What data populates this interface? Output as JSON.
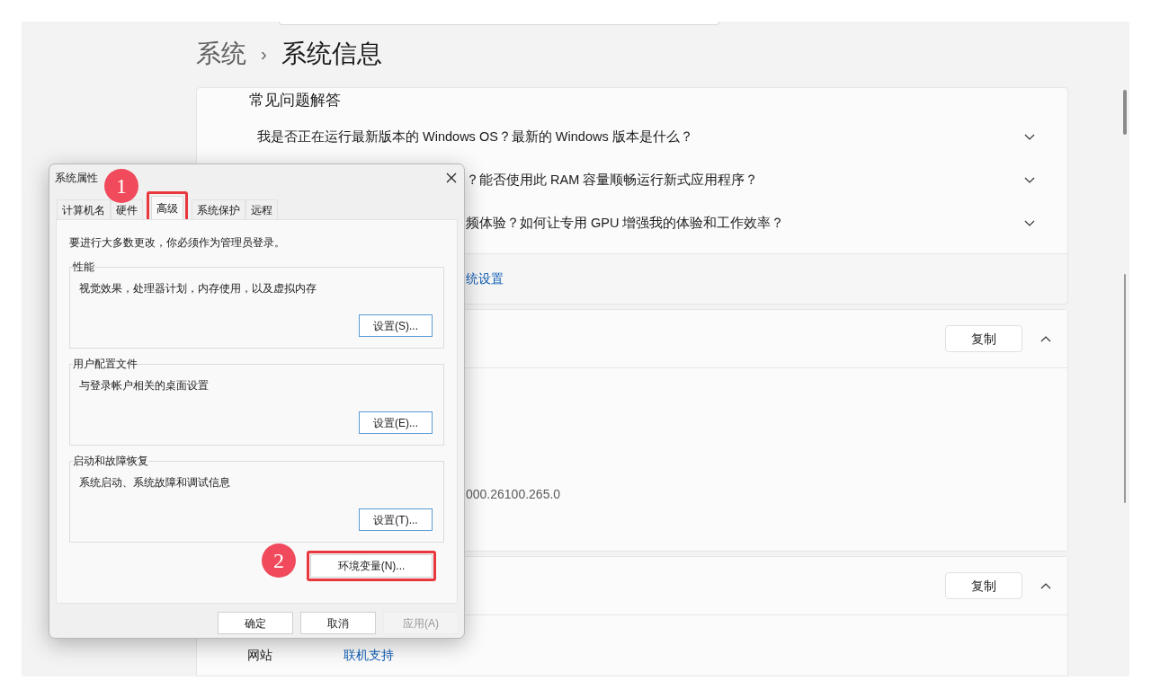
{
  "breadcrumb": {
    "parent": "系统",
    "separator": "›",
    "current": "系统信息"
  },
  "faq": {
    "title": "常见问题解答",
    "items": [
      {
        "question": "我是否正在运行最新版本的 Windows OS？最新的 Windows 版本是什么？",
        "expanded": false,
        "partial": false
      },
      {
        "question": "？能否使用此 RAM 容量顺畅运行新式应用程序？",
        "expanded": false,
        "partial": true
      },
      {
        "question": "频体验？如何让专用 GPU 增强我的体验和工作效率？",
        "expanded": false,
        "partial": true
      }
    ]
  },
  "related_link": "统设置",
  "spec_cards": [
    {
      "copy_button": "复制",
      "expanded": true,
      "value": "000.26100.265.0"
    },
    {
      "copy_button": "复制",
      "expanded": true,
      "label": "网站",
      "link": "联机支持"
    }
  ],
  "dialog": {
    "title": "系统属性",
    "tabs": [
      {
        "label": "计算机名",
        "selected": false,
        "highlighted": false
      },
      {
        "label": "硬件",
        "selected": false,
        "highlighted": false
      },
      {
        "label": "高级",
        "selected": true,
        "highlighted": true
      },
      {
        "label": "系统保护",
        "selected": false,
        "highlighted": false
      },
      {
        "label": "远程",
        "selected": false,
        "highlighted": false
      }
    ],
    "notice": "要进行大多数更改，你必须作为管理员登录。",
    "groups": [
      {
        "title": "性能",
        "description": "视觉效果，处理器计划，内存使用，以及虚拟内存",
        "button": "设置(S)..."
      },
      {
        "title": "用户配置文件",
        "description": "与登录帐户相关的桌面设置",
        "button": "设置(E)..."
      },
      {
        "title": "启动和故障恢复",
        "description": "系统启动、系统故障和调试信息",
        "button": "设置(T)..."
      }
    ],
    "env_button": {
      "label": "环境变量(N)...",
      "highlighted": true
    },
    "footer_buttons": [
      {
        "label": "确定",
        "disabled": false
      },
      {
        "label": "取消",
        "disabled": false
      },
      {
        "label": "应用(A)",
        "disabled": true
      }
    ]
  },
  "step_badges": [
    "1",
    "2"
  ]
}
